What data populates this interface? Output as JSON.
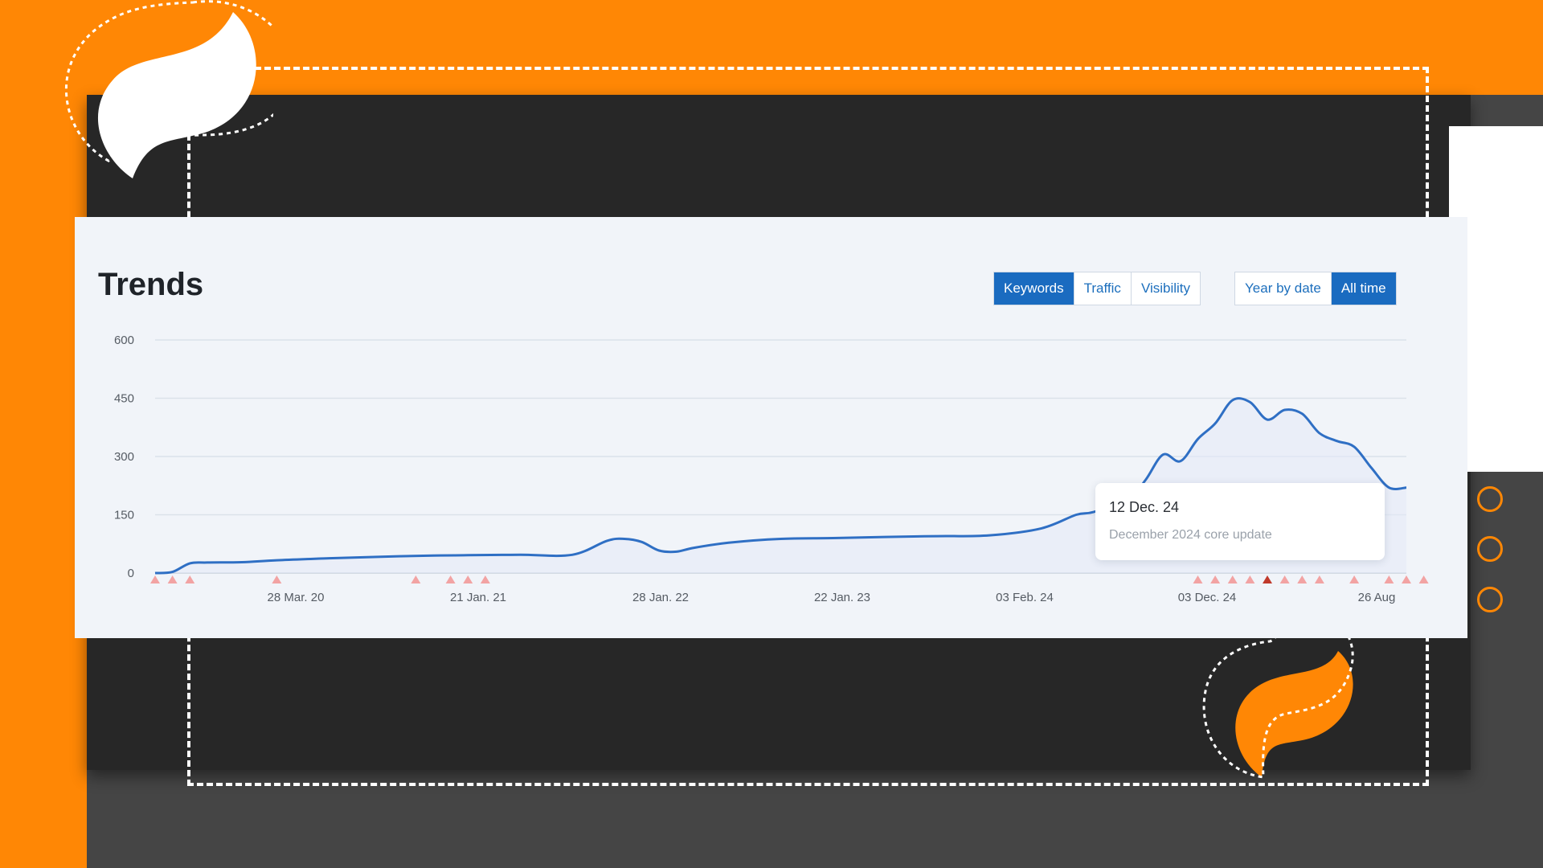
{
  "header": {
    "title": "Trends"
  },
  "metric_buttons": [
    {
      "label": "Keywords",
      "active": true
    },
    {
      "label": "Traffic",
      "active": false
    },
    {
      "label": "Visibility",
      "active": false
    }
  ],
  "range_buttons": [
    {
      "label": "Year by date",
      "active": false
    },
    {
      "label": "All time",
      "active": true
    }
  ],
  "tooltip": {
    "date": "12 Dec. 24",
    "note": "December 2024 core update"
  },
  "colors": {
    "background_orange": "#ff8705",
    "dark_panel": "#272727",
    "line": "#2f6fc4",
    "active_button": "#1a6bc0",
    "update_marker": "#f2a3a3",
    "update_marker_highlight": "#c0392b"
  },
  "decorations": {
    "circles": 3,
    "icons": [
      "leaf-icon-white",
      "leaf-icon-orange"
    ]
  },
  "chart_data": {
    "type": "area",
    "title": "",
    "xlabel": "",
    "ylabel": "",
    "ylim": [
      0,
      600
    ],
    "yticks": [
      "600",
      "450",
      "300",
      "150",
      "0"
    ],
    "xticks": [
      "28 Mar. 20",
      "21 Jan. 21",
      "28 Jan. 22",
      "22 Jan. 23",
      "03 Feb. 24",
      "03 Dec. 24",
      "26 Aug"
    ],
    "grid": true,
    "legend": "none",
    "series": [
      {
        "x": [
          "2019-08",
          "2019-09",
          "2019-10",
          "2019-11",
          "2020-01",
          "2020-03",
          "2020-06",
          "2020-09",
          "2020-12",
          "2021-02",
          "2021-05",
          "2021-08",
          "2021-10",
          "2021-11",
          "2021-12",
          "2022-01",
          "2022-02",
          "2022-03",
          "2022-05",
          "2022-08",
          "2022-11",
          "2023-02",
          "2023-05",
          "2023-08",
          "2023-11",
          "2024-01",
          "2024-02",
          "2024-04",
          "2024-05",
          "2024-06",
          "2024-07",
          "2024-08",
          "2024-09",
          "2024-10",
          "2024-11",
          "2024-12",
          "2025-01",
          "2025-02",
          "2025-03",
          "2025-04",
          "2025-05",
          "2025-06",
          "2025-07",
          "2025-08"
        ],
        "values": [
          0,
          3,
          25,
          27,
          28,
          33,
          38,
          42,
          45,
          46,
          47,
          47,
          83,
          88,
          80,
          58,
          55,
          65,
          78,
          88,
          90,
          93,
          95,
          97,
          115,
          150,
          157,
          190,
          240,
          305,
          288,
          345,
          385,
          445,
          440,
          395,
          420,
          410,
          360,
          340,
          325,
          270,
          220,
          220
        ]
      }
    ],
    "annotations": [
      {
        "date": "12 Dec. 24",
        "text": "December 2024 core update"
      }
    ],
    "update_markers": [
      "2019-08",
      "2019-09",
      "2019-10",
      "2020-03",
      "2020-11",
      "2021-01",
      "2021-02",
      "2021-03",
      "2024-08",
      "2024-09",
      "2024-10",
      "2024-11",
      "2024-12",
      "2025-01",
      "2025-02",
      "2025-03",
      "2025-05",
      "2025-07",
      "2025-08",
      "2025-09"
    ]
  }
}
